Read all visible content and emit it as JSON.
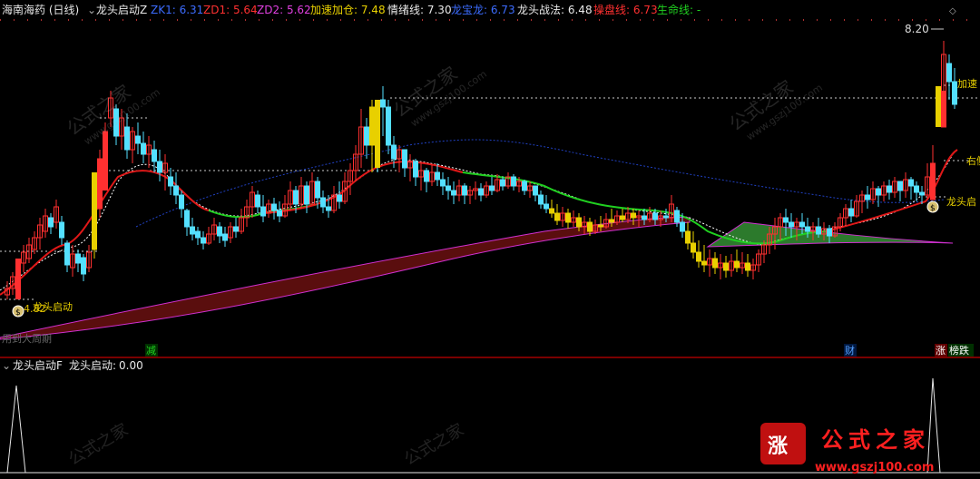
{
  "header": {
    "stock": "海南海药 (日线)",
    "indicator": "龙头启动Z",
    "items": [
      {
        "label": "ZK1:",
        "value": "6.31",
        "color": "#3c6cff"
      },
      {
        "label": "ZD1:",
        "value": "5.64",
        "color": "#ff3030"
      },
      {
        "label": "ZD2:",
        "value": "5.62",
        "color": "#e040e0"
      },
      {
        "label": "加速加仓:",
        "value": "7.48",
        "color": "#e8d000"
      },
      {
        "label": "情绪线:",
        "value": "7.30",
        "color": "#e8e8e8"
      },
      {
        "label": "龙宝龙:",
        "value": "6.73",
        "color": "#3c6cff"
      },
      {
        "label": "龙头战法:",
        "value": "6.48",
        "color": "#e8e8e8"
      },
      {
        "label": "操盘线:",
        "value": "6.73",
        "color": "#ff3030"
      },
      {
        "label": "生命线:",
        "value": "-",
        "color": "#20d020"
      }
    ]
  },
  "price_labels": {
    "high": "8.20",
    "low": "4.82"
  },
  "annotations": {
    "start_left": "龙头启动",
    "accelerate": "加速",
    "right_side": "右侧",
    "start_right": "龙头启",
    "faint_note": "用到大周期"
  },
  "markers": {
    "decrease": "减",
    "wealth": "财",
    "rise": "涨",
    "list_drop": "榜跌"
  },
  "sub": {
    "indicator": "龙头启动F",
    "label": "龙头启动:",
    "value": "0.00"
  },
  "watermark": {
    "cn": "公式之家",
    "url": "www.gszj100.com"
  },
  "colors": {
    "up": "#ff3030",
    "down": "#54e0ff",
    "signal": "#e8d000",
    "red_line": "#e01818",
    "green_line": "#20d020",
    "blue_line": "#2040c0",
    "magenta_line": "#d030d0"
  }
}
